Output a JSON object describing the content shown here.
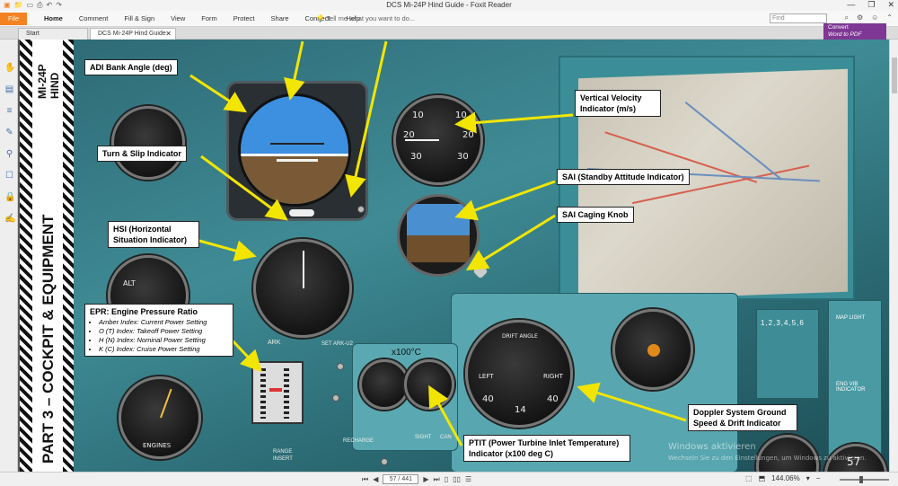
{
  "window": {
    "title": "DCS Mi-24P Hind Guide - Foxit Reader",
    "controls": [
      "—",
      "❐",
      "✕"
    ]
  },
  "ribbon": {
    "file_label": "File",
    "menus": [
      "Home",
      "Comment",
      "Fill & Sign",
      "View",
      "Form",
      "Protect",
      "Share",
      "Connect",
      "Help"
    ],
    "tell_me_placeholder": "Tell me what you want to do...",
    "find_placeholder": "Find"
  },
  "tabs": [
    {
      "label": "Start"
    },
    {
      "label": "DCS Mi-24P Hind Guide"
    }
  ],
  "convert": {
    "line1": "Convert",
    "line2": "Word to PDF"
  },
  "sidebar": {
    "line1": "MI-24P",
    "line2": "HIND",
    "section": "PART 3 – COCKPIT & EQUIPMENT"
  },
  "callouts": {
    "adi": "ADI Bank Angle (deg)",
    "turn_slip": "Turn & Slip Indicator",
    "hsi": "HSI (Horizontal Situation Indicator)",
    "vvi": "Vertical Velocity Indicator (m/s)",
    "sai": "SAI (Standby Attitude Indicator)",
    "sai_cage": "SAI Caging Knob",
    "epr_title": "EPR: Engine Pressure Ratio",
    "epr_items": [
      "Amber Index: Current Power Setting",
      "O (T) Index: Takeoff Power Setting",
      "H (N) Index: Nominal Power Setting",
      "K (C) Index: Cruise Power Setting"
    ],
    "doppler": "Doppler System Ground Speed & Drift Indicator",
    "ptit": "PTIT (Power Turbine Inlet Temperature) Indicator (x100 deg C)"
  },
  "cockpit_labels": {
    "vvi_nums": [
      "10",
      "20",
      "30",
      "10",
      "20",
      "30"
    ],
    "ark": "ARK",
    "set_ark": "SET ARK-U2",
    "ptit_label": "x100°C",
    "drift": "DRIFT ANGLE",
    "left": "LEFT",
    "right": "RIGHT",
    "drift_nums": [
      "40",
      "14",
      "40"
    ],
    "alt": "ALT",
    "engines": "ENGINES",
    "range": "RANGE",
    "insert": "INSERT",
    "recharge": "RECHARGE",
    "sight": "SIGHT",
    "can": "CAN",
    "map_light": "MAP LIGHT",
    "nums_panel": "1,2,3,4,5,6",
    "eng_vib": "ENG VIB INDICATOR",
    "big_num": "57"
  },
  "watermark": {
    "line1": "Windows aktivieren",
    "line2": "Wechseln Sie zu den Einstellungen, um Windows zu aktivieren."
  },
  "statusbar": {
    "page_value": "57 / 441",
    "zoom": "144.06%"
  }
}
